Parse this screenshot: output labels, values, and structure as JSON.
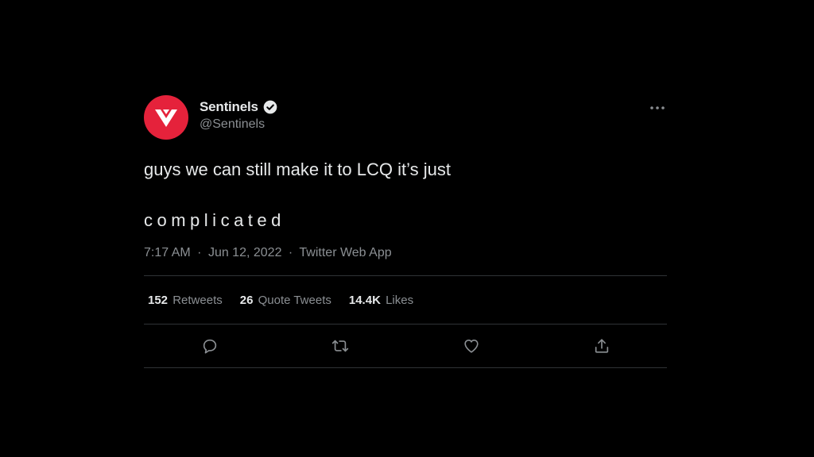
{
  "tweet": {
    "display_name": "Sentinels",
    "handle": "@Sentinels",
    "text_line1": "guys we can still make it to LCQ it’s just",
    "text_line2": "complicated",
    "time": "7:17 AM",
    "date": "Jun 12, 2022",
    "separator": "·",
    "source": "Twitter Web App"
  },
  "stats": {
    "retweets_count": "152",
    "retweets_label": "Retweets",
    "quotes_count": "26",
    "quotes_label": "Quote Tweets",
    "likes_count": "14.4K",
    "likes_label": "Likes"
  },
  "icons": {
    "avatar": "sentinels-logo",
    "verified": "verified-badge-icon",
    "more": "more-icon",
    "reply": "reply-icon",
    "retweet": "retweet-icon",
    "like": "heart-icon",
    "share": "share-icon"
  },
  "colors": {
    "background": "#000000",
    "brand_red": "#e5223b",
    "text_primary": "#e7e9ea",
    "text_secondary": "#8b8f93",
    "divider": "#2f3336"
  }
}
